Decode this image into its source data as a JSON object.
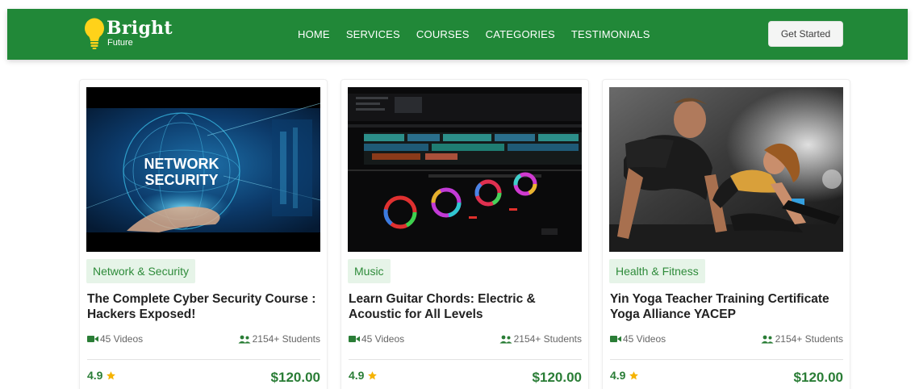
{
  "brand": {
    "name": "Bright",
    "subtitle": "Future"
  },
  "nav": {
    "items": [
      "HOME",
      "SERVICES",
      "COURSES",
      "CATEGORIES",
      "TESTIMONIALS"
    ],
    "cta_label": "Get Started"
  },
  "colors": {
    "nav_bg": "#218838",
    "accent_green": "#2a7d36",
    "tag_bg": "#e6f4e8",
    "star": "#f5b301",
    "bulb": "#ffd21a"
  },
  "courses": [
    {
      "category": "Network & Security",
      "title": "The Complete Cyber Security Course : Hackers Exposed!",
      "image_text": [
        "NETWORK",
        "SECURITY"
      ],
      "videos": "45 Videos",
      "students": "2154+ Students",
      "rating": "4.9",
      "price": "$120.00"
    },
    {
      "category": "Music",
      "title": "Learn Guitar Chords: Electric & Acoustic for All Levels",
      "videos": "45 Videos",
      "students": "2154+ Students",
      "rating": "4.9",
      "price": "$120.00"
    },
    {
      "category": "Health & Fitness",
      "title": "Yin Yoga Teacher Training Certificate Yoga Alliance YACEP",
      "videos": "45 Videos",
      "students": "2154+ Students",
      "rating": "4.9",
      "price": "$120.00"
    }
  ],
  "icons": {
    "logo": "lightbulb-icon",
    "videos": "video-camera-icon",
    "students": "users-icon",
    "rating": "star-icon"
  }
}
